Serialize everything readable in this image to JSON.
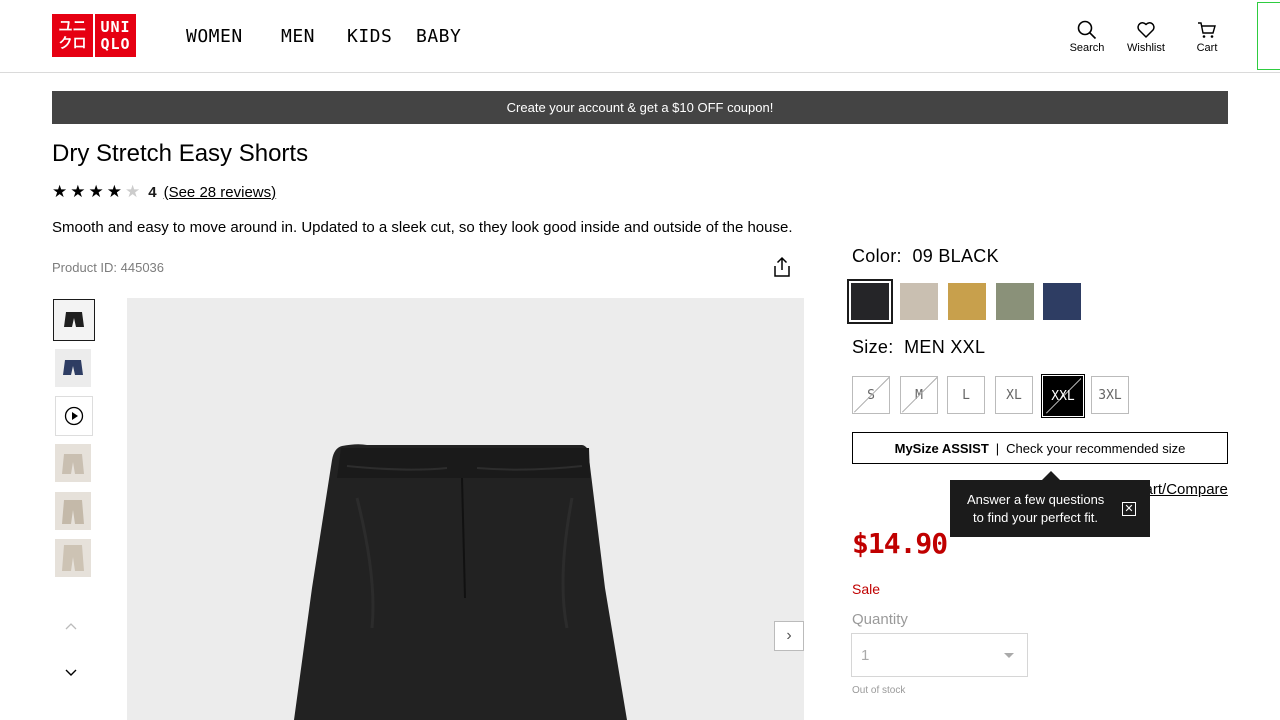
{
  "header": {
    "logo": {
      "line1": "ユニ",
      "line2": "クロ",
      "line3": "UNI",
      "line4": "QLO"
    },
    "nav": [
      "WOMEN",
      "MEN",
      "KIDS",
      "BABY"
    ],
    "search_label": "Search",
    "wishlist_label": "Wishlist",
    "cart_label": "Cart"
  },
  "promo": {
    "text": "Create your account & get a $10 OFF coupon!"
  },
  "product": {
    "title": "Dry Stretch Easy Shorts",
    "rating": 4,
    "rating_text": "4",
    "reviews_link": "(See 28 reviews)",
    "description": "Smooth and easy to move around in. Updated to a sleek cut, so they look good inside and outside of the house.",
    "product_id": "Product ID: 445036"
  },
  "options": {
    "color_label": "Color:",
    "color_value": "09 BLACK",
    "colors": [
      {
        "name": "black",
        "hex": "#252528",
        "selected": true
      },
      {
        "name": "beige",
        "hex": "#c9bfb1"
      },
      {
        "name": "mustard",
        "hex": "#c8a04c"
      },
      {
        "name": "olive",
        "hex": "#8a9179"
      },
      {
        "name": "navy",
        "hex": "#2e3d63"
      }
    ],
    "size_label": "Size:",
    "size_value": "MEN XXL",
    "sizes": [
      {
        "label": "S",
        "available": false
      },
      {
        "label": "M",
        "available": false
      },
      {
        "label": "L",
        "available": true
      },
      {
        "label": "XL",
        "available": true
      },
      {
        "label": "XXL",
        "available": true,
        "selected": true
      },
      {
        "label": "3XL",
        "available": true
      }
    ]
  },
  "mysize": {
    "brand": "MySize ASSIST",
    "separator": "|",
    "text": "Check your recommended size"
  },
  "size_chart": {
    "label": "Size Chart/Compare"
  },
  "tooltip": {
    "line1": "Answer a few questions",
    "line2": "to find your perfect fit.",
    "close": "✕"
  },
  "price": {
    "value": "$14.90",
    "sale_label": "Sale"
  },
  "quantity": {
    "label": "Quantity",
    "value": "1",
    "status": "Out of stock"
  },
  "carousel": {
    "next": "›",
    "up": "⌃",
    "down": "⌄"
  },
  "colors": {
    "brand_red": "#e60012",
    "price_red": "#c00000",
    "promo_bg": "#444444"
  }
}
